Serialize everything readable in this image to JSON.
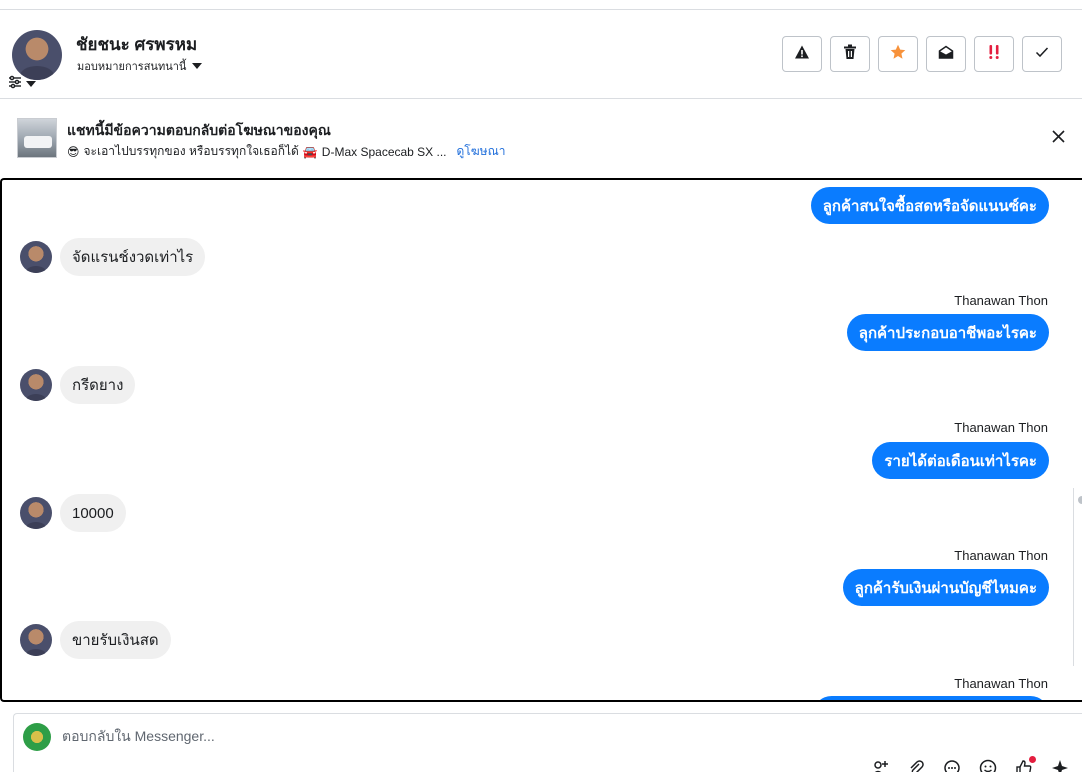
{
  "header": {
    "name": "ชัยชนะ ศรพรหม",
    "assign_label": "มอบหมายการสนทนานี้",
    "actions": [
      {
        "icon": "warning-icon"
      },
      {
        "icon": "trash-icon"
      },
      {
        "icon": "star-icon",
        "color": "#f7923b"
      },
      {
        "icon": "mark-unread-icon"
      },
      {
        "icon": "follow-up-icon",
        "color": "#e41e3f"
      },
      {
        "icon": "check-icon"
      }
    ]
  },
  "ad": {
    "title": "แชทนี้มีข้อความตอบกลับต่อโฆษณาของคุณ",
    "emoji_1": "😎",
    "snippet": "จะเอาไปบรรทุกของ หรือบรรทุกใจเธอก็ได้",
    "emoji_2": "🚘",
    "snippet_2": "D-Max Spacecab SX ...",
    "link": "ดูโฆษณา"
  },
  "messages": [
    {
      "dir": "out",
      "text": "ลูกค้าสนใจซื้อสดหรือจัดแนนซ์คะ"
    },
    {
      "dir": "in",
      "text": "จัดแรนช์งวดเท่าไร"
    },
    {
      "dir": "out",
      "sender": "Thanawan Thon",
      "text": "ลุกค้าประกอบอาชีพอะไรคะ"
    },
    {
      "dir": "in",
      "text": "กรีดยาง"
    },
    {
      "dir": "out",
      "sender": "Thanawan Thon",
      "text": "รายได้ต่อเดือนเท่าไรคะ"
    },
    {
      "dir": "in",
      "text": "10000"
    },
    {
      "dir": "out",
      "sender": "Thanawan Thon",
      "text": "ลูกค้ารับเงินผ่านบัญชีไหมคะ"
    },
    {
      "dir": "in",
      "text": "ขายรับเงินสด"
    },
    {
      "dir": "out",
      "sender": "Thanawan Thon",
      "text": ""
    }
  ],
  "composer": {
    "placeholder": "ตอบกลับใน Messenger..."
  },
  "colors": {
    "outgoing_bubble": "#0a7cff",
    "incoming_bubble": "#f0f0f0",
    "link": "#216fdb"
  }
}
